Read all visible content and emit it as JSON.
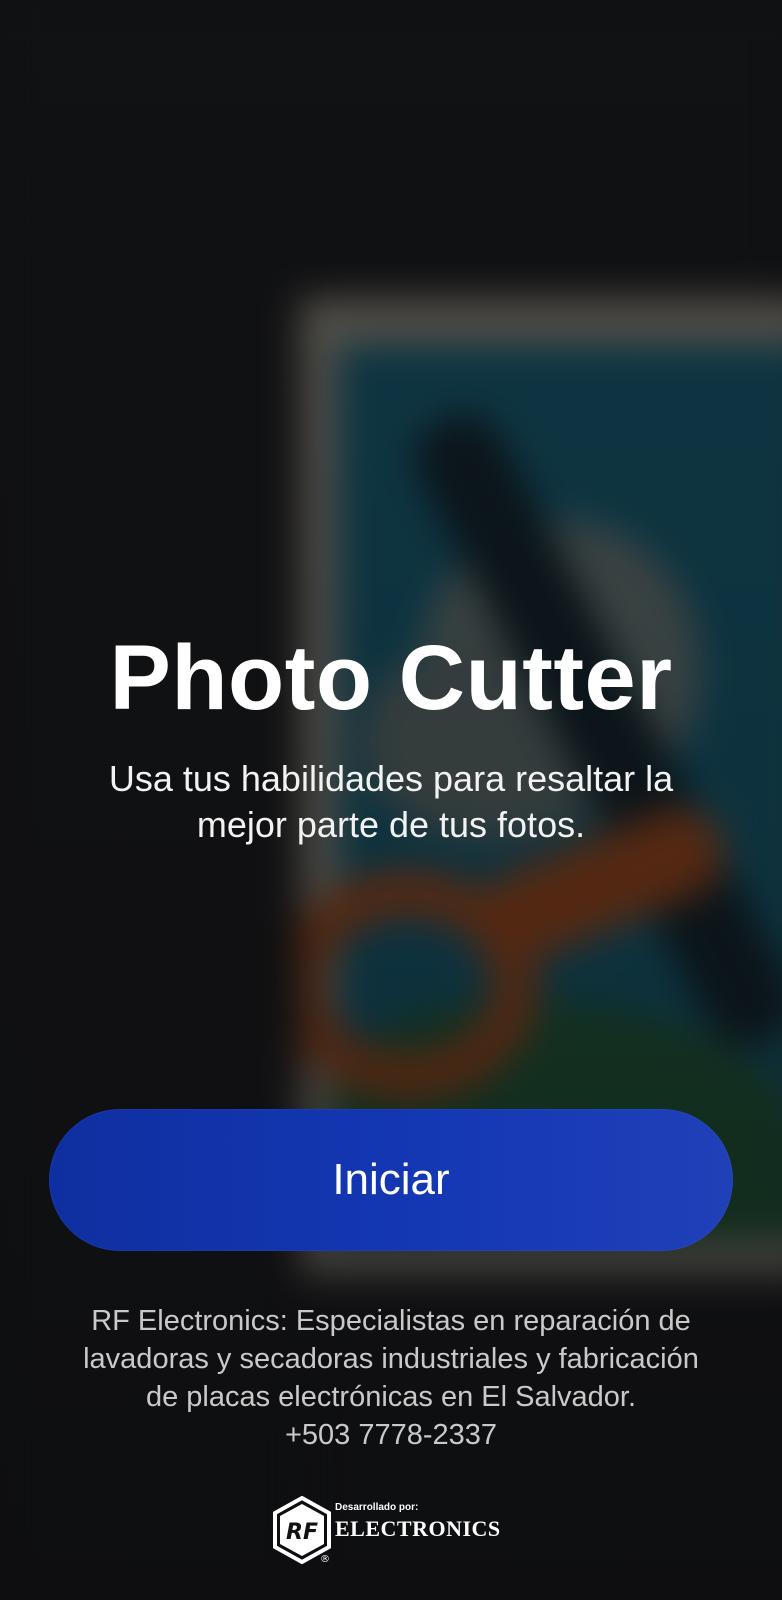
{
  "app": {
    "title": "Photo Cutter",
    "subtitle": "Usa tus habilidades para resaltar la mejor parte de tus fotos."
  },
  "actions": {
    "start_label": "Iniciar"
  },
  "footer": {
    "lines": [
      "RF Electronics: Especialistas en reparación de",
      "lavadoras y secadoras industriales y fabricación",
      "de placas electrónicas en El Salvador.",
      "+503 7778-2337"
    ]
  },
  "brand": {
    "developed_by": "Desarrollado por:",
    "logo_text": "RF",
    "name": "ELECTRONICS",
    "registered": "®"
  },
  "colors": {
    "background": "#131416",
    "button": "#1437b4",
    "text_primary": "#ffffff",
    "text_secondary": "#c9c9c9"
  },
  "icons": {
    "background_art": "scissors-cutting-photo-illustration",
    "brand_logo": "rf-hexagon-logo"
  }
}
